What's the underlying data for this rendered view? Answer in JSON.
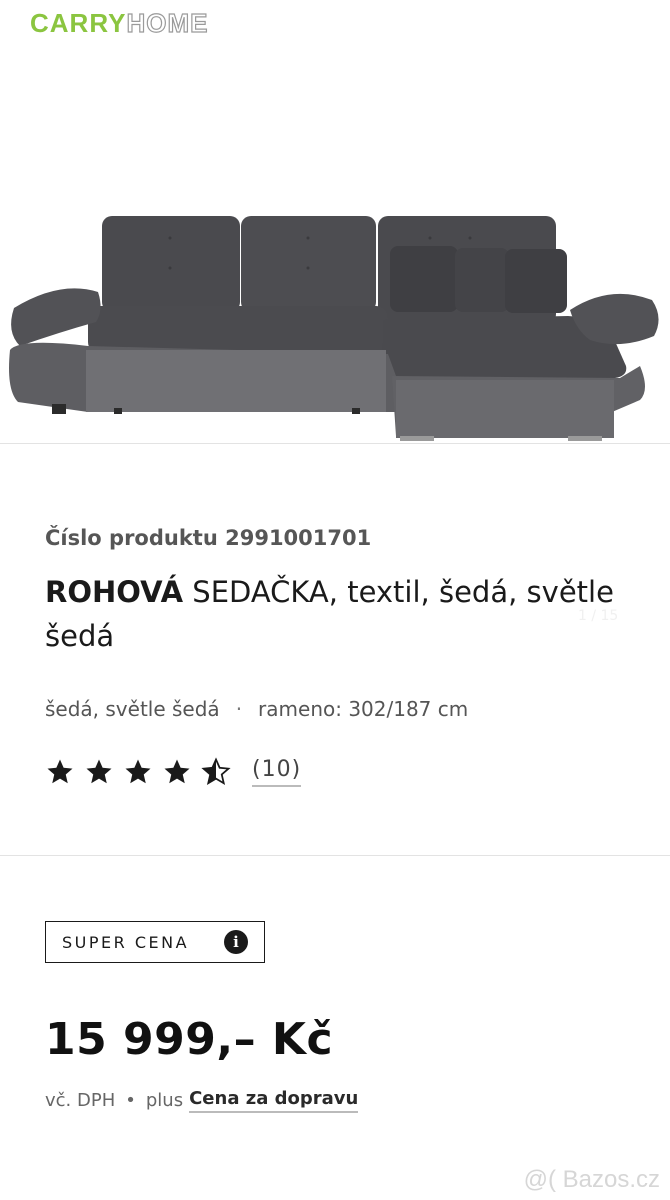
{
  "header": {
    "logo_part1": "CARRY",
    "logo_part2": "HOME"
  },
  "gallery": {
    "counter": "1 / 15",
    "image": "corner-sofa-photo"
  },
  "product": {
    "number_label": "Číslo produktu 2991001701",
    "title_bold": "ROHOVÁ",
    "title_rest": " SEDAČKA, textil, šedá, světle šedá",
    "color": "šedá, světle šedá",
    "separator": "·",
    "dimensions": "rameno: 302/187 cm",
    "rating": {
      "value": 4.5,
      "max": 5,
      "count_label": "(10)"
    }
  },
  "badge": {
    "label": "SUPER CENA",
    "icon": "info-icon"
  },
  "pricing": {
    "price": "15 999,– Kč",
    "tax": "vč. DPH",
    "bullet": "•",
    "plus": "plus",
    "shipping_link": "Cena za dopravu"
  },
  "watermark": "@( Bazos.cz",
  "colors": {
    "brand_green": "#8bc540",
    "text_dark": "#1a1a1a",
    "sofa_dark": "#4a4a4e",
    "sofa_light": "#6e6e72"
  }
}
